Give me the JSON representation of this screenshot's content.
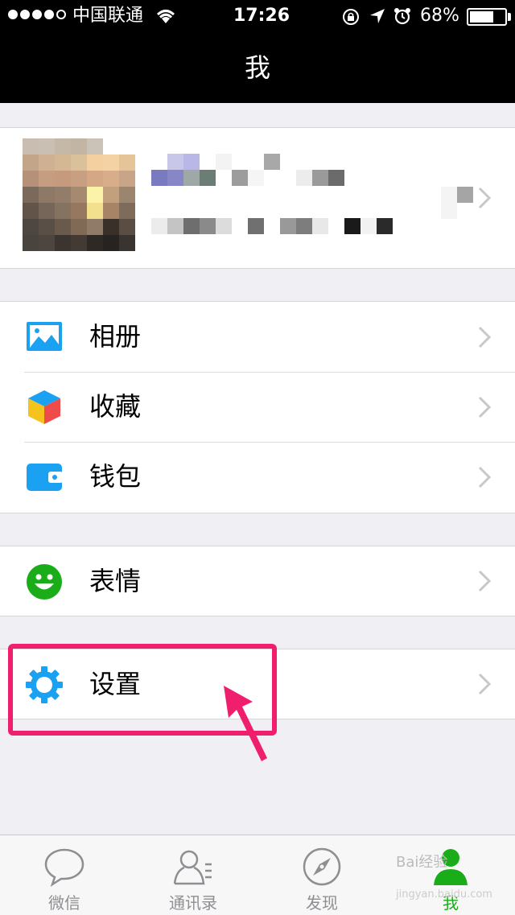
{
  "status_bar": {
    "carrier": "中国联通",
    "time": "17:26",
    "battery_percent": "68%",
    "battery_level": 0.68
  },
  "nav": {
    "title": "我"
  },
  "profile": {
    "avatar_icon": "pixelated-avatar"
  },
  "menu": {
    "album": {
      "label": "相册",
      "icon": "album-icon"
    },
    "favorites": {
      "label": "收藏",
      "icon": "cube-icon"
    },
    "wallet": {
      "label": "钱包",
      "icon": "wallet-icon"
    },
    "stickers": {
      "label": "表情",
      "icon": "smiley-icon"
    },
    "settings": {
      "label": "设置",
      "icon": "gear-icon"
    }
  },
  "tabbar": {
    "tabs": [
      {
        "label": "微信",
        "icon": "chat-bubble-icon"
      },
      {
        "label": "通讯录",
        "icon": "contacts-icon"
      },
      {
        "label": "发现",
        "icon": "compass-icon"
      },
      {
        "label": "我",
        "icon": "me-icon"
      }
    ],
    "active_index": 3
  },
  "watermark": {
    "text": "Bai经验",
    "sub": "jingyan.baidu.com"
  },
  "colors": {
    "accent": "#1aad19",
    "icon_blue": "#1aa1f2",
    "highlight": "#f01f6e"
  }
}
